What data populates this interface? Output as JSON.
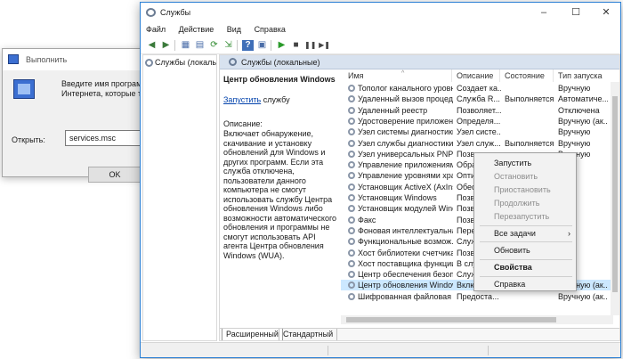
{
  "run": {
    "title": "Выполнить",
    "desc1": "Введите имя программы,",
    "desc2": "Интернета, которые треб",
    "open_label": "Открыть:",
    "input_value": "services.msc",
    "ok": "OK"
  },
  "window": {
    "title": "Службы",
    "minimize": "–",
    "maximize": "☐",
    "close": "✕"
  },
  "menu": [
    "Файл",
    "Действие",
    "Вид",
    "Справка"
  ],
  "toolbar": {
    "back": "◀",
    "forward": "▶",
    "up": "▦",
    "properties": "▤",
    "refresh": "⟳",
    "export": "⇲",
    "help": "?",
    "panel": "▣",
    "start": "▶",
    "stop": "■",
    "pause": "❚❚",
    "restart": "▶❚"
  },
  "tree": {
    "item": "Службы (локальны"
  },
  "pane": {
    "header": "Службы (локальные)",
    "service_name": "Центр обновления Windows",
    "start_link": "Запустить",
    "start_suffix": " службу",
    "desc_label": "Описание:",
    "desc_text": "Включает обнаружение, скачивание и установку обновлений для Windows и других программ. Если эта служба отключена, пользователи данного компьютера не смогут использовать службу Центра обновления Windows либо возможности автоматического обновления и программы не смогут использовать API агента Центра обновления Windows (WUA)."
  },
  "columns": [
    "Имя",
    "Описание",
    "Состояние",
    "Тип запуска"
  ],
  "rows": [
    [
      "Тополог канального уровня",
      "Создает ка...",
      "",
      "Вручную"
    ],
    [
      "Удаленный вызов процеду...",
      "Служба R...",
      "Выполняется",
      "Автоматиче..."
    ],
    [
      "Удаленный реестр",
      "Позволяет...",
      "",
      "Отключена"
    ],
    [
      "Удостоверение приложения",
      "Определя...",
      "",
      "Вручную (ак..."
    ],
    [
      "Узел системы диагностики",
      "Узел систе...",
      "",
      "Вручную"
    ],
    [
      "Узел службы диагностики",
      "Узел служ...",
      "Выполняется",
      "Вручную"
    ],
    [
      "Узел универсальных PNP-...",
      "Позволяет...",
      "",
      "Вручную"
    ],
    [
      "Управление приложениями",
      "Обра",
      "",
      ""
    ],
    [
      "Управление уровнями хра...",
      "Опти",
      "",
      ""
    ],
    [
      "Установщик ActiveX (AxIns...",
      "Обес",
      "",
      ""
    ],
    [
      "Установщик Windows",
      "Позв",
      "",
      ""
    ],
    [
      "Установщик модулей Wind...",
      "Позв",
      "",
      ""
    ],
    [
      "Факс",
      "Позв",
      "",
      ""
    ],
    [
      "Фоновая интеллектуальна...",
      "Пере",
      "",
      ""
    ],
    [
      "Функциональные возмож...",
      "Служ",
      "",
      ""
    ],
    [
      "Хост библиотеки счетчика...",
      "Позв",
      "",
      ""
    ],
    [
      "Хост поставщика функции...",
      "В слу",
      "",
      ""
    ],
    [
      "Центр обеспечения безоп...",
      "Служ",
      "",
      ""
    ],
    [
      "Центр обновления Windows",
      "Включает...",
      "",
      "Вручную (ак..."
    ],
    [
      "Шифрованная файловая с...",
      "Предоста...",
      "",
      "Вручную (ак..."
    ]
  ],
  "tabs": [
    "Расширенный",
    "Стандартный"
  ],
  "context_menu": {
    "start": "Запустить",
    "stop": "Остановить",
    "pause": "Приостановить",
    "resume": "Продолжить",
    "restart": "Перезапустить",
    "all_tasks": "Все задачи",
    "refresh": "Обновить",
    "properties": "Свойства",
    "help": "Справка",
    "submenu_arrow": "›"
  }
}
